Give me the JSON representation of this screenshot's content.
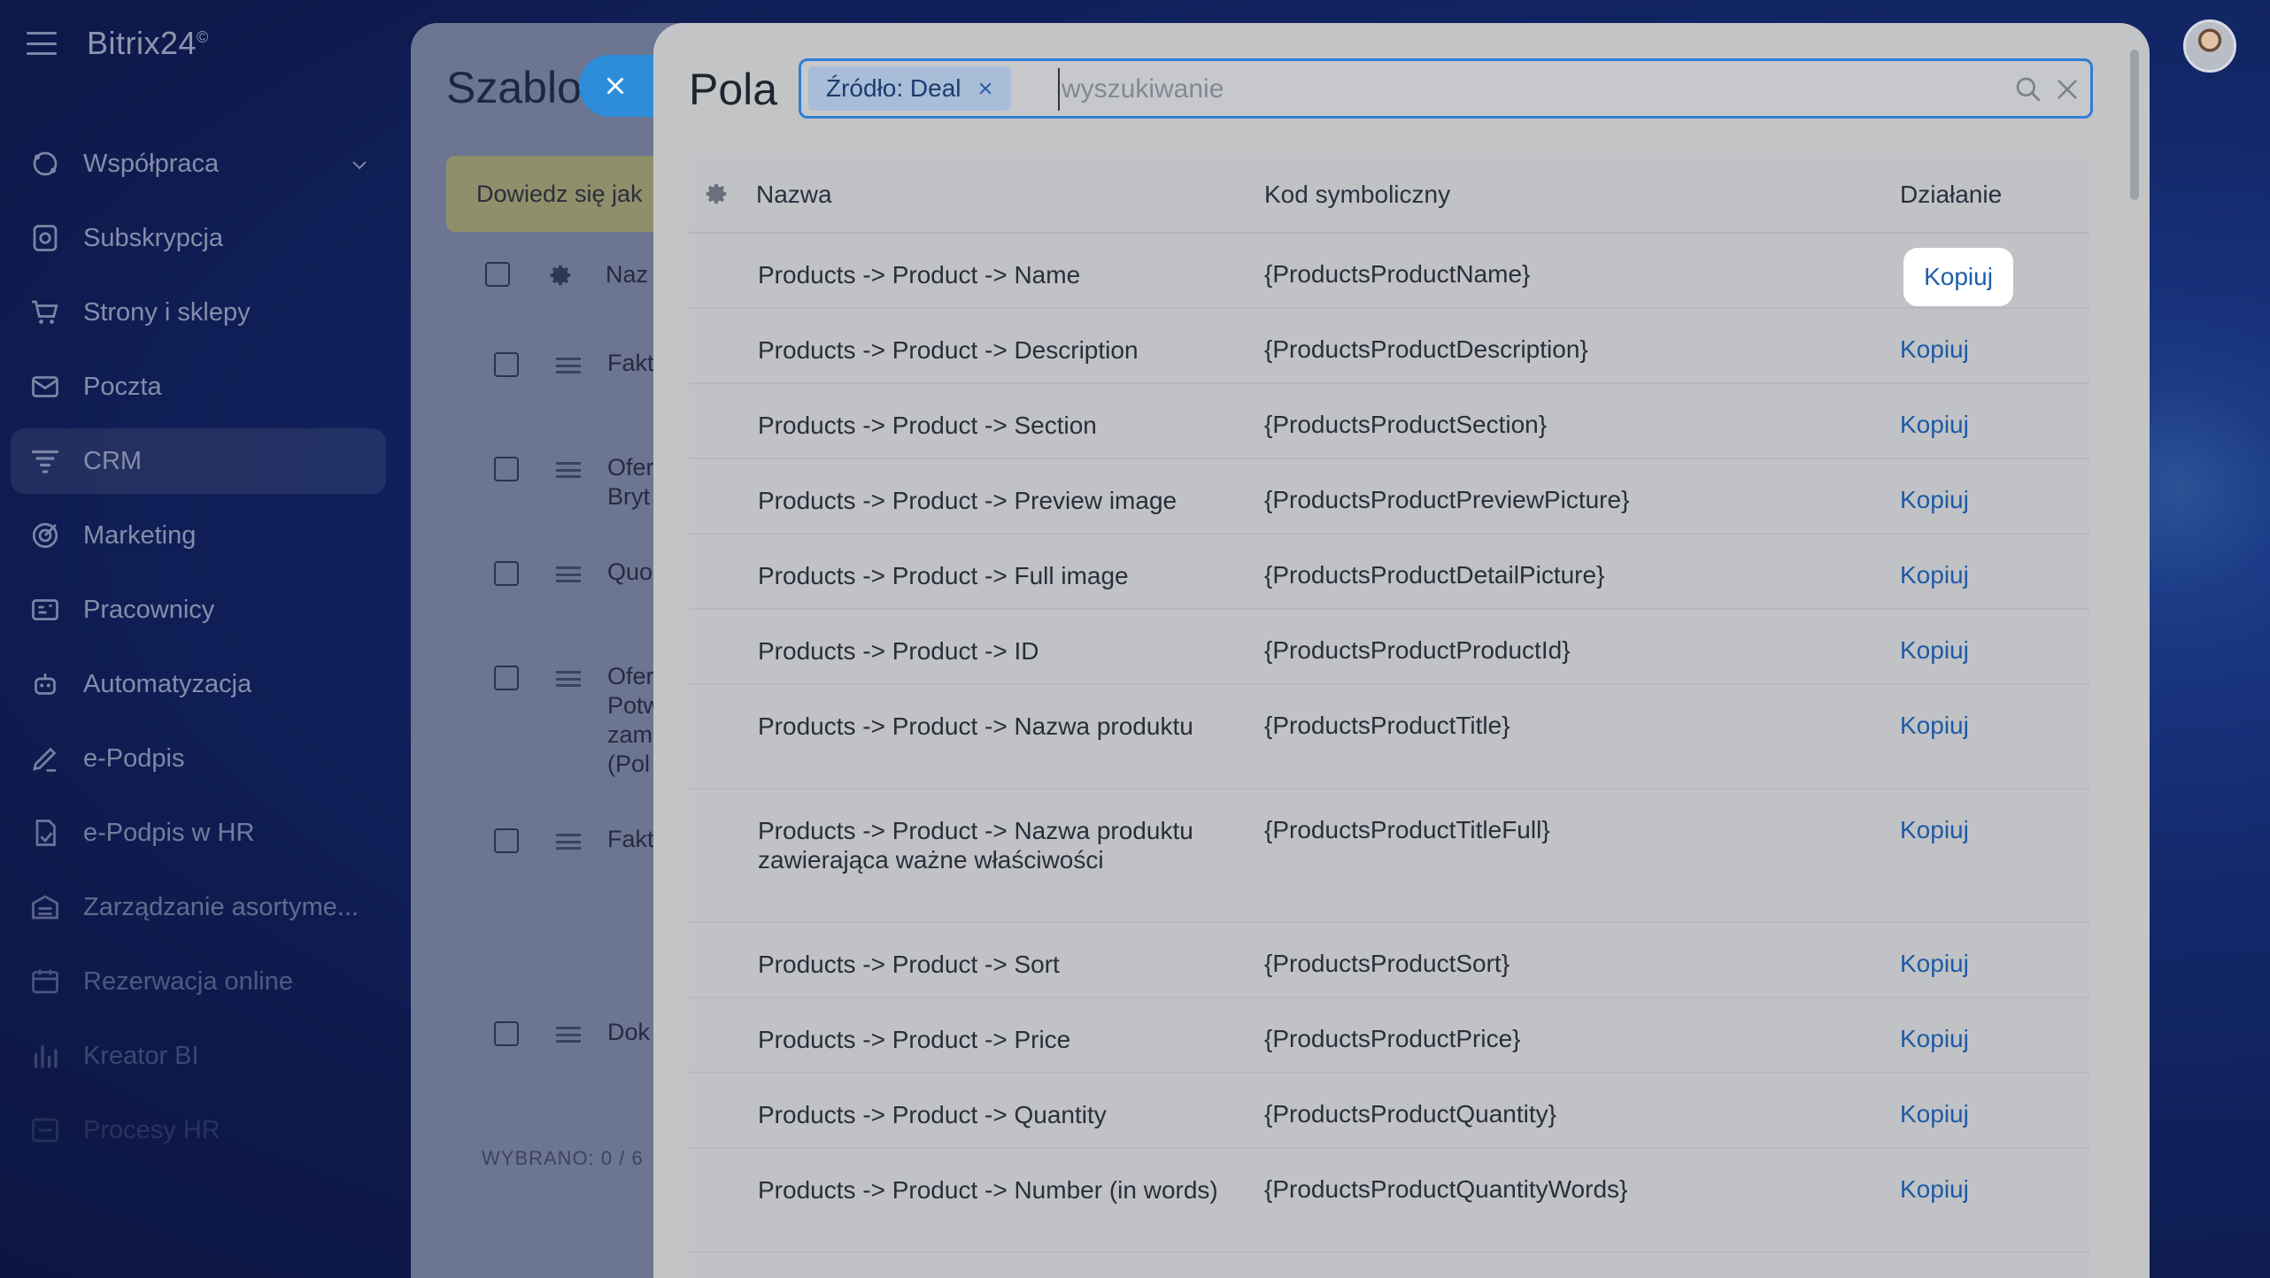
{
  "brand": {
    "name": "Bitrix24",
    "mark": "©"
  },
  "sidebar": {
    "items": [
      {
        "label": "Współpraca",
        "icon": "collaboration-icon",
        "has_chevron": true
      },
      {
        "label": "Subskrypcja",
        "icon": "subscription-icon"
      },
      {
        "label": "Strony i sklepy",
        "icon": "cart-icon"
      },
      {
        "label": "Poczta",
        "icon": "mail-icon"
      },
      {
        "label": "CRM",
        "icon": "crm-filter-icon",
        "active": true
      },
      {
        "label": "Marketing",
        "icon": "target-icon"
      },
      {
        "label": "Pracownicy",
        "icon": "id-card-icon"
      },
      {
        "label": "Automatyzacja",
        "icon": "robot-icon"
      },
      {
        "label": "e-Podpis",
        "icon": "pen-icon"
      },
      {
        "label": "e-Podpis w HR",
        "icon": "signed-document-icon"
      },
      {
        "label": "Zarządzanie asortyme...",
        "icon": "warehouse-icon"
      },
      {
        "label": "Rezerwacja online",
        "icon": "calendar-icon"
      },
      {
        "label": "Kreator BI",
        "icon": "bar-chart-icon"
      },
      {
        "label": "Procesy HR",
        "icon": "hr-process-icon"
      }
    ]
  },
  "back_panel": {
    "title": "Szablo",
    "banner": "Dowiedz się jak",
    "header_label": "Naz",
    "rows": [
      "Fakt",
      "Ofer\nBryt",
      "Quo",
      "Ofer\nPotw\nzam\n(Pol",
      "Fakt",
      "Dok"
    ],
    "footer_label": "WYBRANO:",
    "footer_value": "0 / 6"
  },
  "modal": {
    "title": "Pola",
    "filter_chip": "Źródło: Deal",
    "search_placeholder": "wyszukiwanie",
    "columns": {
      "name": "Nazwa",
      "code": "Kod symboliczny",
      "action": "Działanie"
    },
    "rows": [
      {
        "name": "Products -> Product -> Name",
        "code": "{ProductsProductName}",
        "action": "Kopiuj",
        "highlight": true
      },
      {
        "name": "Products -> Product -> Description",
        "code": "{ProductsProductDescription}",
        "action": "Kopiuj"
      },
      {
        "name": "Products -> Product -> Section",
        "code": "{ProductsProductSection}",
        "action": "Kopiuj"
      },
      {
        "name": "Products -> Product -> Preview image",
        "code": "{ProductsProductPreviewPicture}",
        "action": "Kopiuj"
      },
      {
        "name": "Products -> Product -> Full image",
        "code": "{ProductsProductDetailPicture}",
        "action": "Kopiuj"
      },
      {
        "name": "Products -> Product -> ID",
        "code": "{ProductsProductProductId}",
        "action": "Kopiuj"
      },
      {
        "name": "Products -> Product -> Nazwa produktu",
        "code": "{ProductsProductTitle}",
        "action": "Kopiuj"
      },
      {
        "name": "Products -> Product -> Nazwa produktu zawierająca ważne właściwości",
        "code": "{ProductsProductTitleFull}",
        "action": "Kopiuj"
      },
      {
        "name": "Products -> Product -> Sort",
        "code": "{ProductsProductSort}",
        "action": "Kopiuj"
      },
      {
        "name": "Products -> Product -> Price",
        "code": "{ProductsProductPrice}",
        "action": "Kopiuj"
      },
      {
        "name": "Products -> Product -> Quantity",
        "code": "{ProductsProductQuantity}",
        "action": "Kopiuj"
      },
      {
        "name": "Products -> Product -> Number (in words)",
        "code": "{ProductsProductQuantityWords}",
        "action": "Kopiuj"
      }
    ]
  },
  "colors": {
    "accent": "#2f7fd3",
    "link": "#1d5aa6",
    "sidebar_bg": "#0e1f6b"
  }
}
